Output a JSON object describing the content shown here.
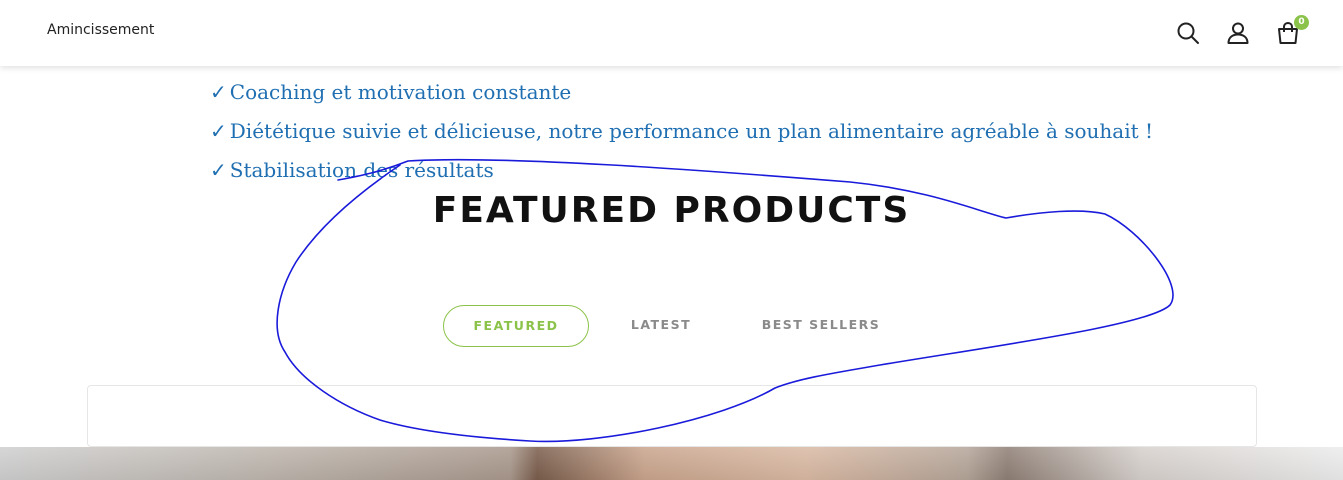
{
  "header": {
    "nav_link": "Amincissement",
    "cart_count": "0",
    "icons": [
      "search-icon",
      "user-icon",
      "cart-icon"
    ]
  },
  "features": {
    "check": "✓",
    "items": [
      "Coaching et motivation constante",
      "Diététique suivie et délicieuse, notre performance un plan alimentaire agréable à souhait !",
      "Stabilisation des résultats"
    ]
  },
  "section": {
    "title": "FEATURED PRODUCTS"
  },
  "tabs": {
    "active": "FEATURED",
    "items": [
      "FEATURED",
      "LATEST",
      "BEST SELLERS"
    ]
  },
  "colors": {
    "accent": "#8bc34a",
    "feature_text": "#1f6fb2",
    "annotation": "#1a1adb"
  }
}
